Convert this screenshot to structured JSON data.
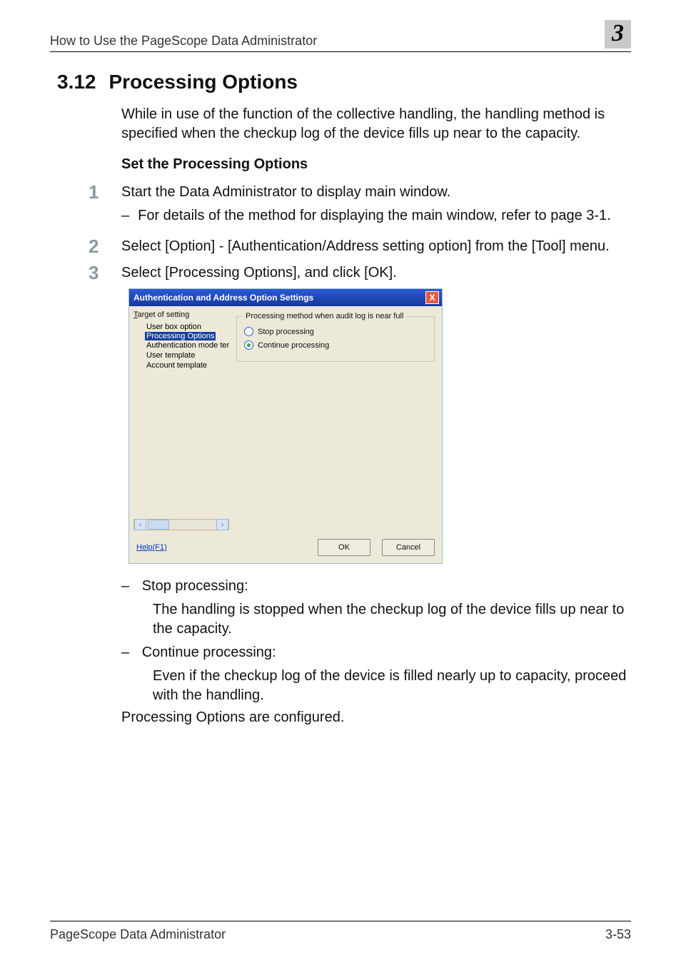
{
  "running": {
    "left": "How to Use the PageScope Data Administrator",
    "chapter": "3"
  },
  "section": {
    "number": "3.12",
    "title": "Processing Options"
  },
  "intro": "While in use of the function of the collective handling, the handling method is specified when the checkup log of the device fills up near to the capacity.",
  "sub_heading": "Set the Processing Options",
  "steps": {
    "s1": {
      "num": "1",
      "text": "Start the Data Administrator to display main window.",
      "sub1": "For details of the method for displaying the main window, refer to page 3-1."
    },
    "s2": {
      "num": "2",
      "text": "Select [Option] - [Authentication/Address setting option] from the [Tool] menu."
    },
    "s3": {
      "num": "3",
      "text": "Select [Processing Options], and click [OK].",
      "opt1_name": "Stop processing:",
      "opt1_desc": "The handling is stopped when the checkup log of the device fills up near to the capacity.",
      "opt2_name": "Continue processing:",
      "opt2_desc": "Even if the checkup log of the device is filled nearly up to capacity, proceed with the handling.",
      "closing": "Processing Options are configured."
    }
  },
  "dialog": {
    "title": "Authentication and Address Option Settings",
    "close": "X",
    "tree_label_pre": "T",
    "tree_label_rest": "arget of setting",
    "tree": {
      "i1": "User box option",
      "i2": "Processing Options",
      "i3": "Authentication mode tem",
      "i4": "User template",
      "i5": "Account template"
    },
    "group_legend": "Processing method when audit log is near full",
    "radio1": "Stop processing",
    "radio2": "Continue processing",
    "scroll_left": "‹",
    "scroll_right": "›",
    "help": "Help(F1)",
    "ok": "OK",
    "cancel": "Cancel"
  },
  "footer": {
    "left": "PageScope Data Administrator",
    "right": "3-53"
  }
}
